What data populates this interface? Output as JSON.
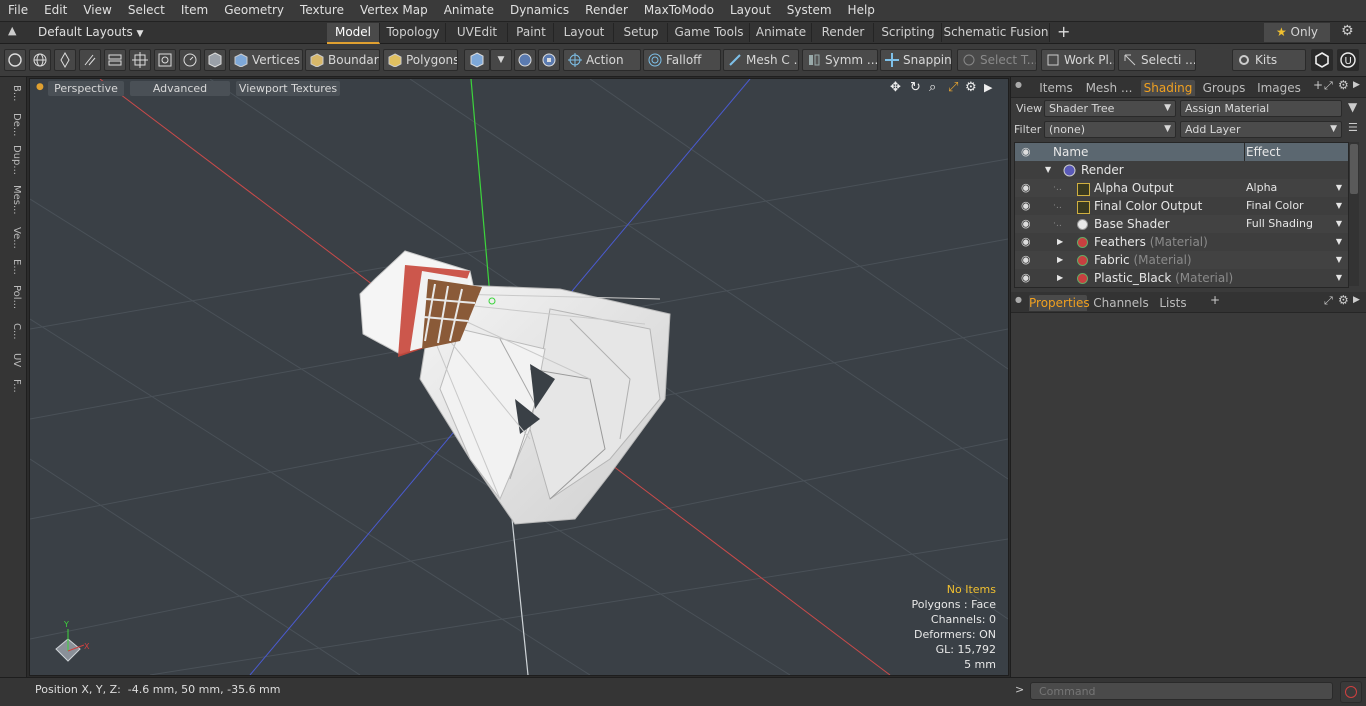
{
  "menu": [
    "File",
    "Edit",
    "View",
    "Select",
    "Item",
    "Geometry",
    "Texture",
    "Vertex Map",
    "Animate",
    "Dynamics",
    "Render",
    "MaxToModo",
    "Layout",
    "System",
    "Help"
  ],
  "layout_selector": "Default Layouts",
  "layout_tabs": [
    "Model",
    "Topology",
    "UVEdit",
    "Paint",
    "Layout",
    "Setup",
    "Game Tools",
    "Animate",
    "Render",
    "Scripting",
    "Schematic Fusion"
  ],
  "only_label": "Only",
  "toolbar": {
    "vertices": "Vertices",
    "boundary": "Boundary",
    "polygons": "Polygons",
    "action": "Action",
    "falloff": "Falloff",
    "mesh": "Mesh C ...",
    "symm": "Symm ...",
    "snapping": "Snapping",
    "select_t": "Select T...",
    "workpl": "Work Pl...",
    "selecti": "Selecti ...",
    "kits": "Kits"
  },
  "left_tabs": [
    "B...",
    "De...",
    "Dup...",
    "Mes...",
    "Ve...",
    "E...",
    "Pol...",
    "C...",
    "UV",
    "F..."
  ],
  "viewport": {
    "perspective": "Perspective",
    "advanced": "Advanced",
    "textures": "Viewport Textures",
    "info": {
      "no_items": "No Items",
      "polygons": "Polygons : Face",
      "channels": "Channels: 0",
      "deformers": "Deformers: ON",
      "gl": "GL: 15,792",
      "scale": "5 mm"
    }
  },
  "status": "Position X, Y, Z:  -4.6 mm, 50 mm, -35.6 mm",
  "right_tabs": [
    "Items",
    "Mesh ...",
    "Shading",
    "Groups",
    "Images"
  ],
  "view_label": "View",
  "view_value": "Shader Tree",
  "assign_material": "Assign Material",
  "filter_label": "Filter",
  "filter_value": "(none)",
  "add_layer": "Add Layer",
  "tree": {
    "col_name": "Name",
    "col_effect": "Effect",
    "rows": [
      {
        "name": "Render",
        "sub": "",
        "effect": ""
      },
      {
        "name": "Alpha Output",
        "sub": "",
        "effect": "Alpha"
      },
      {
        "name": "Final Color Output",
        "sub": "",
        "effect": "Final Color"
      },
      {
        "name": "Base Shader",
        "sub": "",
        "effect": "Full Shading"
      },
      {
        "name": "Feathers",
        "sub": "(Material)",
        "effect": ""
      },
      {
        "name": "Fabric",
        "sub": "(Material)",
        "effect": ""
      },
      {
        "name": "Plastic_Black",
        "sub": "(Material)",
        "effect": ""
      }
    ]
  },
  "bottom_tabs": [
    "Properties",
    "Channels",
    "Lists"
  ],
  "command_placeholder": "Command",
  "colors": {
    "accent": "#f0a020",
    "x_axis": "#d03a3a",
    "y_axis": "#3ad03a",
    "z_axis": "#4a5ad8"
  }
}
